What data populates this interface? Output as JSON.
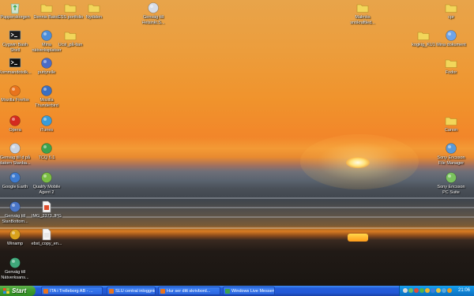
{
  "desktop": {
    "icons": [
      {
        "label": "Papperskorgen",
        "icon": "recycle-bin-icon",
        "color": "#3aa543"
      },
      {
        "label": "Dennis Baton",
        "icon": "folder-icon",
        "color": "#f2d65a"
      },
      {
        "label": "CSS portfolio",
        "icon": "folder-icon",
        "color": "#f2d65a"
      },
      {
        "label": "Nydiden",
        "icon": "folder-icon",
        "color": "#f2d65a"
      },
      {
        "label": "Genväg till\nHelsinki.S...",
        "icon": "shortcut-icon",
        "color": "#d7dde6"
      },
      {
        "label": "Malmös\nsnökraftled...",
        "icon": "folder-icon",
        "color": "#f2d65a"
      },
      {
        "label": "cpr",
        "icon": "folder-icon",
        "color": "#f2d65a"
      },
      {
        "label": "Cygwin Bash\nShell",
        "icon": "terminal-icon",
        "color": "#1c1c1c"
      },
      {
        "label": "Mina\nnätverksplatser",
        "icon": "network-places-icon",
        "color": "#4d8ed8"
      },
      {
        "label": "Ucsl_på-tian",
        "icon": "folder-icon",
        "color": "#f2d65a"
      },
      {
        "label": "kogkig_KU1",
        "icon": "folder-icon",
        "color": "#f2d65a"
      },
      {
        "label": "Mina dokument",
        "icon": "my-documents-icon",
        "color": "#6fa4e8"
      },
      {
        "label": "Kommandotolk...",
        "icon": "command-prompt-icon",
        "color": "#101010"
      },
      {
        "label": "puttyrelle",
        "icon": "putty-icon",
        "color": "#4a6cc6"
      },
      {
        "label": "Fodor",
        "icon": "folder-icon",
        "color": "#f2d65a"
      },
      {
        "label": "Mozilla Firefox",
        "icon": "firefox-icon",
        "color": "#e8731d"
      },
      {
        "label": "Mozilla\nThunderbird",
        "icon": "thunderbird-icon",
        "color": "#3b6fc2"
      },
      {
        "label": "Opera",
        "icon": "opera-icon",
        "color": "#d42a1f"
      },
      {
        "label": "iTunes",
        "icon": "itunes-icon",
        "color": "#3a9cd8"
      },
      {
        "label": "Canon",
        "icon": "folder-icon",
        "color": "#f2d65a"
      },
      {
        "label": "Genväg till d på\ndatorn Stanba...",
        "icon": "shortcut-icon",
        "color": "#c9d3e0"
      },
      {
        "label": "TCQ 6.1",
        "icon": "tcq-icon",
        "color": "#3da24d"
      },
      {
        "label": "Sony Ericsson\nFile Manager",
        "icon": "sony-ericsson-file-manager-icon",
        "color": "#5a9ad8"
      },
      {
        "label": "Google Earth",
        "icon": "google-earth-icon",
        "color": "#3d7bd0"
      },
      {
        "label": "Qualify Mobile\nAgent 2",
        "icon": "mobile-agent-icon",
        "color": "#7bbd43"
      },
      {
        "label": "Sony Ericsson\nPC Suite",
        "icon": "sony-ericsson-pc-suite-icon",
        "color": "#7ac35e"
      },
      {
        "label": "Genväg till\nStanBottom...",
        "icon": "shortcut-icon",
        "color": "#4a76c8"
      },
      {
        "label": "IMG_2373.JPG",
        "icon": "image-file-icon",
        "color": "#e04e2d"
      },
      {
        "label": "Winamp",
        "icon": "winamp-icon",
        "color": "#d9a21c"
      },
      {
        "label": "ebst_copy_en...",
        "icon": "document-file-icon",
        "color": "#e8e8e8"
      },
      {
        "label": "Genväg till\nNätverksans...",
        "icon": "network-shortcut-icon",
        "color": "#3fa87a"
      }
    ]
  },
  "taskbar": {
    "start_label": "Start",
    "tasks": [
      {
        "label": "ITA i Trelleborg AB - ...",
        "icon": "firefox-icon",
        "color": "#e8731d"
      },
      {
        "label": "SLU central inloggnin...",
        "icon": "firefox-icon",
        "color": "#e8731d"
      },
      {
        "label": "Hur ser ditt skrivbord...",
        "icon": "firefox-icon",
        "color": "#e8731d"
      },
      {
        "label": "Windows Live Messen...",
        "icon": "messenger-icon",
        "color": "#3da24d"
      }
    ],
    "tray_icons": [
      "volume-icon",
      "network-icon",
      "antivirus-icon",
      "messenger-icon",
      "shield-icon",
      "bluetooth-icon",
      "update-icon",
      "sync-icon",
      "winamp-icon"
    ],
    "clock": "21:06"
  },
  "colors": {
    "taskbar": "#245edc",
    "start": "#3c9a2e",
    "tray": "#0f85d6"
  }
}
